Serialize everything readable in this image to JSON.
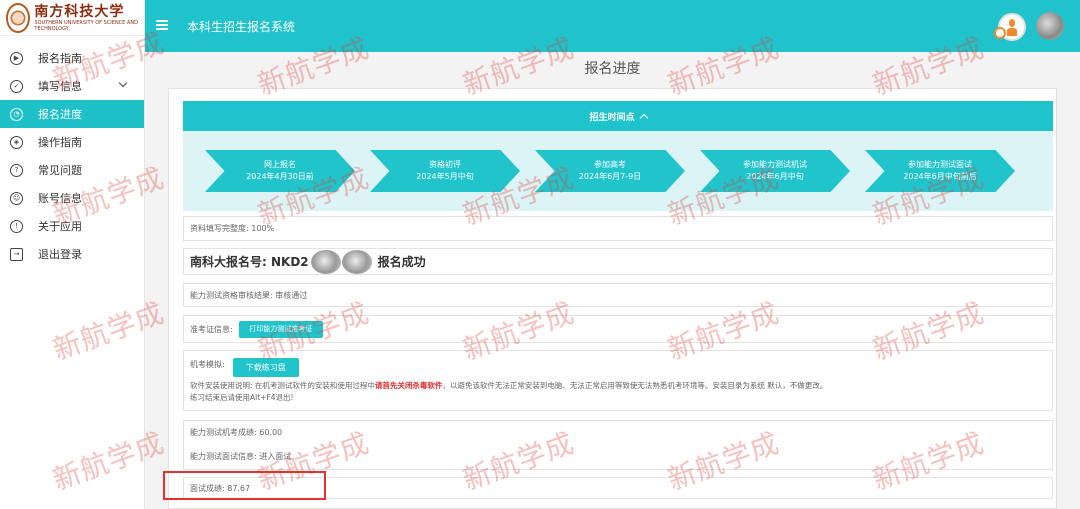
{
  "logo": {
    "name_cn": "南方科技大学",
    "name_en": "SOUTHERN UNIVERSITY OF SCIENCE AND TECHNOLOGY"
  },
  "sidebar": {
    "items": [
      {
        "label": "报名指南",
        "icon": "play-circle-icon"
      },
      {
        "label": "填写信息",
        "icon": "check-circle-icon"
      },
      {
        "label": "报名进度",
        "icon": "gauge-icon"
      },
      {
        "label": "操作指南",
        "icon": "compass-icon"
      },
      {
        "label": "常见问题",
        "icon": "question-circle-icon"
      },
      {
        "label": "账号信息",
        "icon": "user-circle-icon"
      },
      {
        "label": "关于应用",
        "icon": "info-circle-icon"
      },
      {
        "label": "退出登录",
        "icon": "logout-icon"
      }
    ]
  },
  "header": {
    "title": "本科生招生报名系统"
  },
  "main": {
    "title": "报名进度",
    "timeline": {
      "heading": "招生时间点",
      "steps": [
        {
          "name": "网上报名",
          "date": "2024年4月30日前"
        },
        {
          "name": "资格初评",
          "date": "2024年5月中旬"
        },
        {
          "name": "参加高考",
          "date": "2024年6月7-9日"
        },
        {
          "name": "参加能力测试机试",
          "date": "2024年6月中旬"
        },
        {
          "name": "参加能力测试面试",
          "date": "2024年6月中旬前后"
        }
      ]
    },
    "completeness": "资料填写完整度: 100%",
    "registration": {
      "prefix": "南科大报名号: NKD2",
      "suffix": "报名成功"
    },
    "audit": "能力测试资格审核结果: 审核通过",
    "admit": {
      "label": "准考证信息:",
      "button": "打印能力测试准考证"
    },
    "mock": {
      "label": "机考模拟:",
      "button": "下载练习盘",
      "note_before": "软件安装使用说明: 在机考测试软件的安装和使用过程中",
      "note_warn": "请首先关闭杀毒软件",
      "note_after": "，以避免该软件无法正常安装到电脑、无法正常启用等致使无法熟悉机考环境等。安装目录为系统 默认，不做更改。",
      "exit_note": "练习结束后请使用Alt+F4退出!"
    },
    "scores": {
      "machine": "能力测试机考成绩: 60.00",
      "interview_info": "能力测试面试信息: 进入面试"
    },
    "interview_score": "面试成绩: 87.67"
  },
  "watermark": "新航学成",
  "colors": {
    "accent": "#20c3cb",
    "warning": "#e02f2f",
    "highlight_box": "#e53030"
  }
}
